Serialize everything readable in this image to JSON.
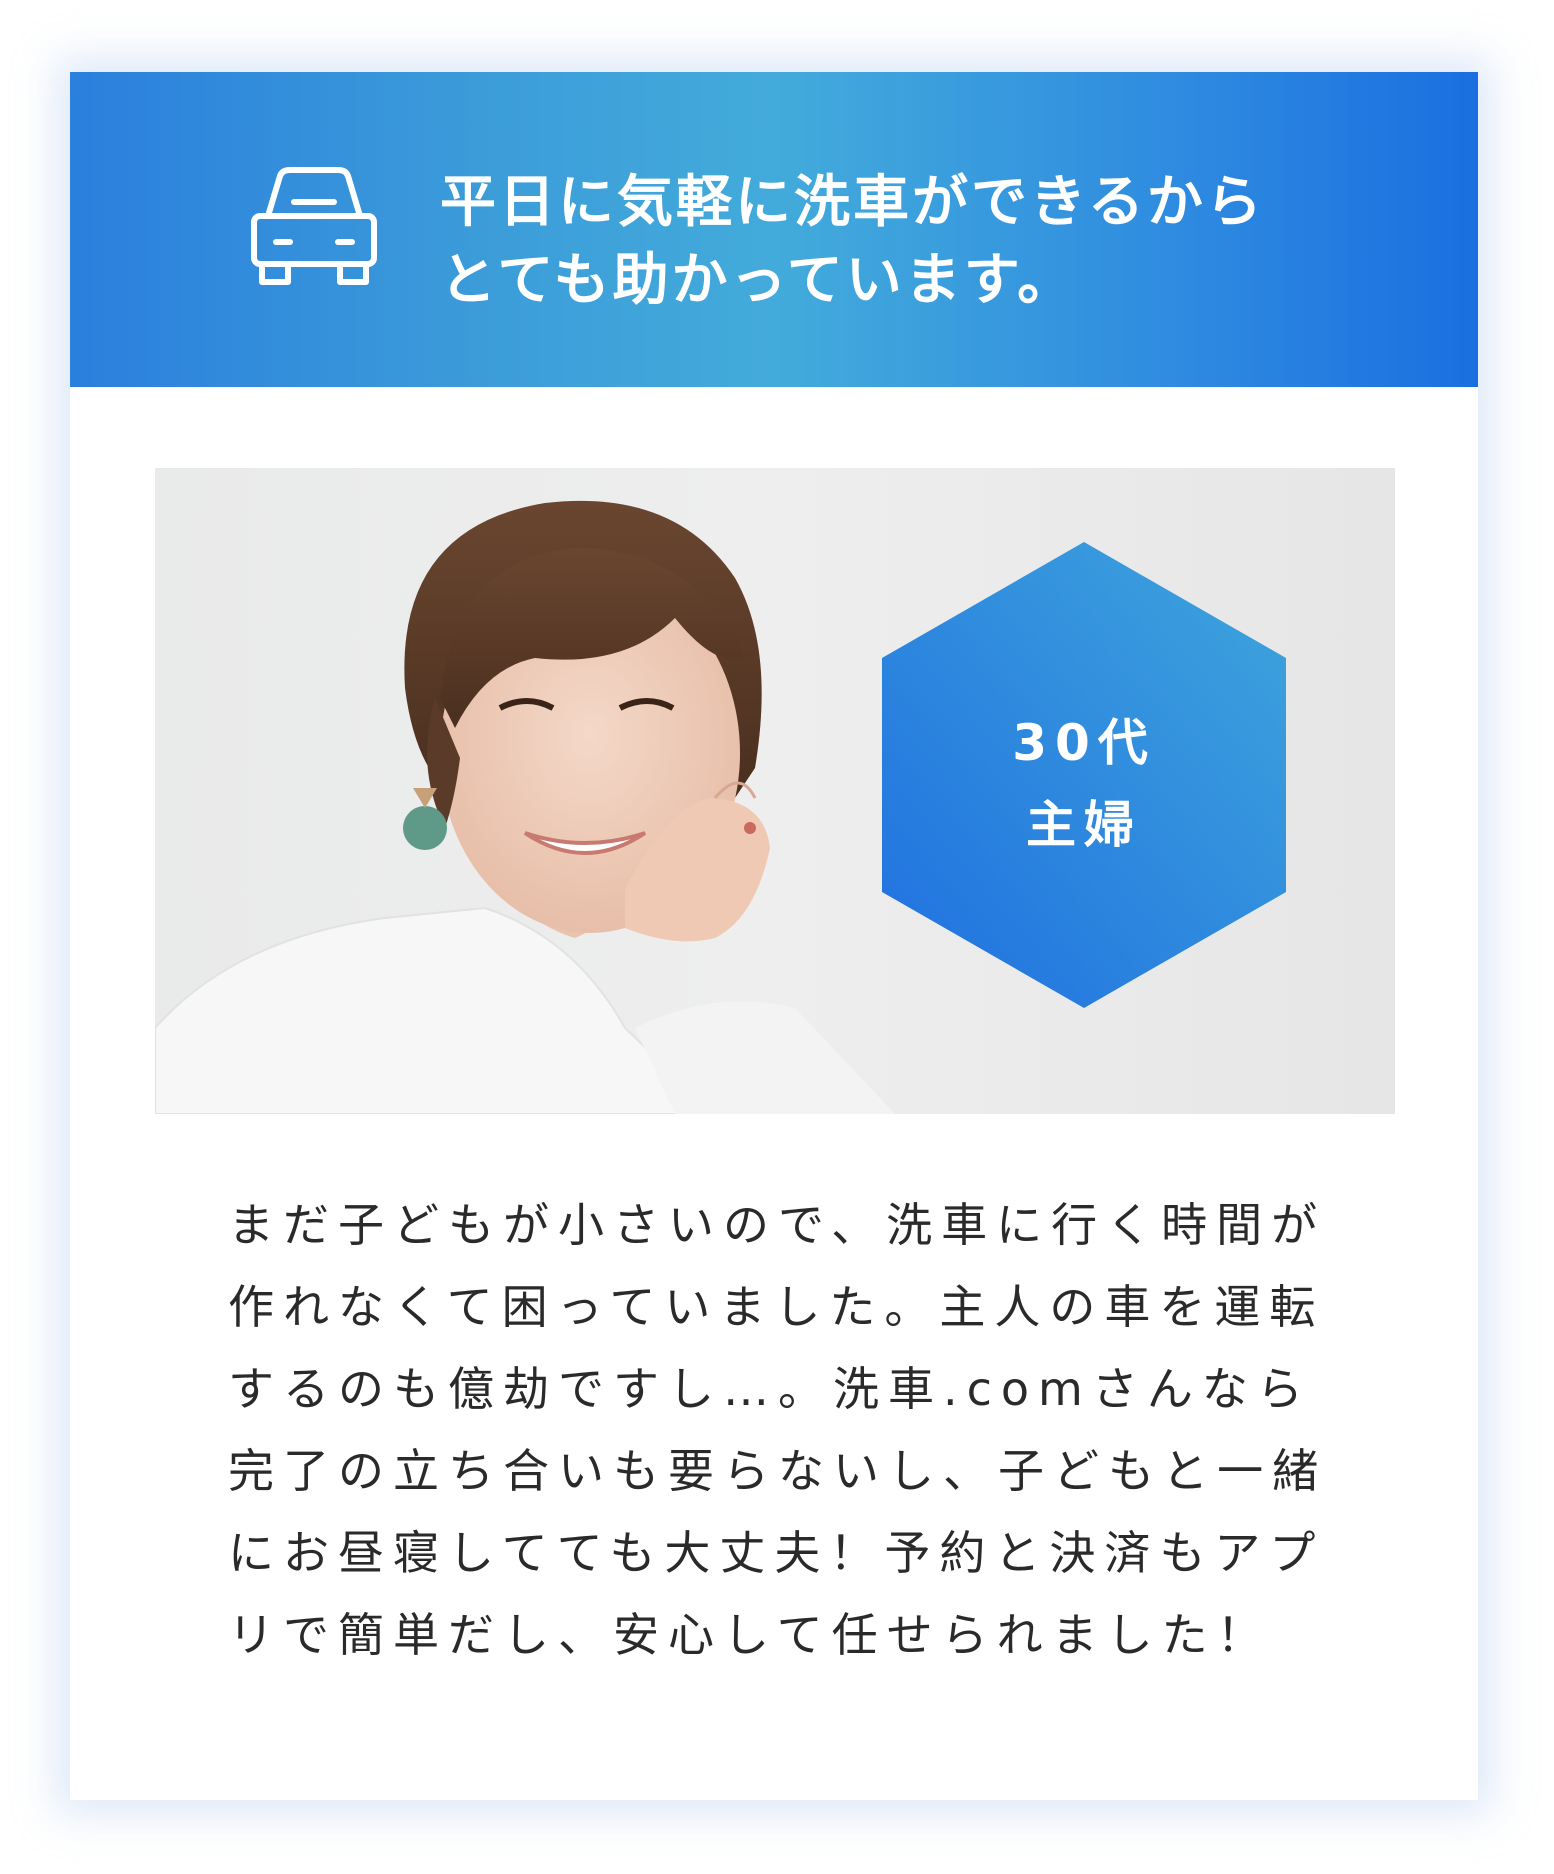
{
  "header": {
    "icon": "car-icon",
    "title_lines": [
      "平日に気軽に洗車ができるから",
      "とても助かっています。"
    ]
  },
  "profile": {
    "badge_lines": [
      "30代",
      "主婦"
    ]
  },
  "testimonial": {
    "lines": [
      "まだ子どもが小さいので、洗車に行く時間が",
      "作れなくて困っていました。主人の車を運転",
      "するのも億劫ですし…。洗車.comさんなら",
      "完了の立ち合いも要らないし、子どもと一緒",
      "にお昼寝してても大丈夫！予約と決済もアプ",
      "リで簡単だし、安心して任せられました！"
    ]
  },
  "colors": {
    "header_gradient_start": "#2b7fdd",
    "header_gradient_mid": "#43abdb",
    "header_gradient_end": "#1a6fe0",
    "badge_top": "#3fa6dc",
    "badge_bottom": "#1f6fe0",
    "text": "#2a2a2a"
  }
}
